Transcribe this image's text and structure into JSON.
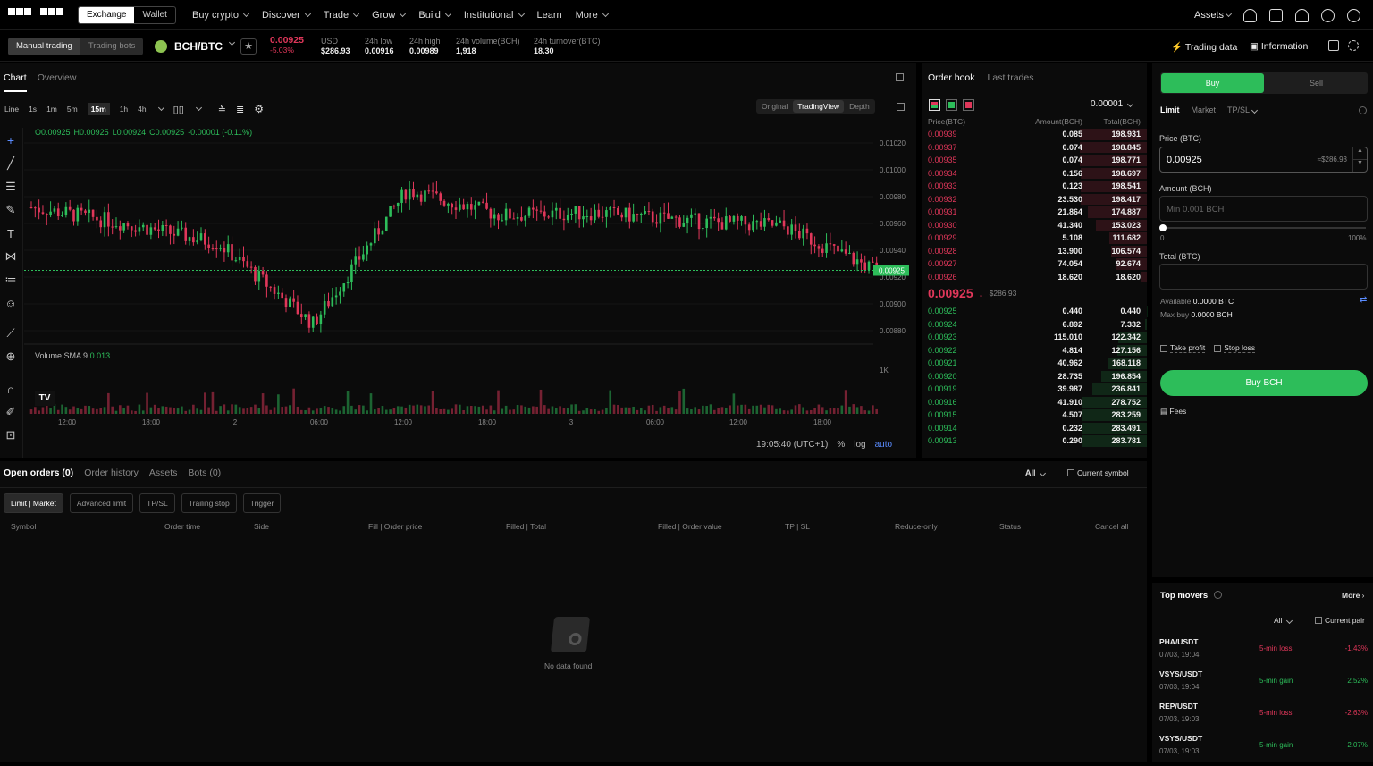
{
  "nav": {
    "exchange": "Exchange",
    "wallet": "Wallet",
    "menu": [
      "Buy crypto",
      "Discover",
      "Trade",
      "Grow",
      "Build",
      "Institutional",
      "Learn",
      "More"
    ],
    "assets": "Assets"
  },
  "ticker": {
    "mode": [
      "Manual trading",
      "Trading bots"
    ],
    "pair": "BCH/BTC",
    "price": "0.00925",
    "change": "-5.03%",
    "usd_label": "USD",
    "usd": "$286.93",
    "low_label": "24h low",
    "low": "0.00916",
    "high_label": "24h high",
    "high": "0.00989",
    "vol_label": "24h volume(BCH)",
    "vol": "1,918",
    "turn_label": "24h turnover(BTC)",
    "turn": "18.30",
    "trading_data": "Trading data",
    "information": "Information"
  },
  "chart": {
    "tabs": [
      "Chart",
      "Overview"
    ],
    "intervals": [
      "Line",
      "1s",
      "1m",
      "5m",
      "15m",
      "1h",
      "4h"
    ],
    "views": [
      "Original",
      "TradingView",
      "Depth"
    ],
    "ohlc_o": "O0.00925",
    "ohlc_h": "H0.00925",
    "ohlc_l": "L0.00924",
    "ohlc_c": "C0.00925",
    "ohlc_chg": "-0.00001 (-0.11%)",
    "volume_label": "Volume SMA 9",
    "volume_val": "0.013",
    "yticks": [
      "0.01020",
      "0.01000",
      "0.00980",
      "0.00960",
      "0.00940",
      "0.00920",
      "0.00900",
      "0.00880"
    ],
    "vol_tick": "1K",
    "xticks": [
      "12:00",
      "18:00",
      "2",
      "06:00",
      "12:00",
      "18:00",
      "3",
      "06:00",
      "12:00",
      "18:00"
    ],
    "last_price": "0.00925",
    "time": "19:05:40 (UTC+1)",
    "pct": "%",
    "log": "log",
    "auto": "auto"
  },
  "chart_data": {
    "type": "line",
    "title": "",
    "x": [
      "12:00",
      "18:00",
      "2",
      "06:00",
      "12:00",
      "18:00",
      "3",
      "06:00",
      "12:00",
      "18:00"
    ],
    "series": [
      {
        "name": "",
        "values": [
          0.00972,
          0.0096,
          0.00945,
          0.00885,
          0.00985,
          0.00966,
          0.00968,
          0.00962,
          0.00958,
          0.00925
        ]
      }
    ],
    "ylim": [
      0.0087,
      0.0103
    ]
  },
  "orderbook": {
    "tabs": [
      "Order book",
      "Last trades"
    ],
    "tick": "0.00001",
    "headers": [
      "Price(BTC)",
      "Amount(BCH)",
      "Total(BCH)"
    ],
    "asks": [
      [
        "0.00939",
        "0.085",
        "198.931"
      ],
      [
        "0.00937",
        "0.074",
        "198.845"
      ],
      [
        "0.00935",
        "0.074",
        "198.771"
      ],
      [
        "0.00934",
        "0.156",
        "198.697"
      ],
      [
        "0.00933",
        "0.123",
        "198.541"
      ],
      [
        "0.00932",
        "23.530",
        "198.417"
      ],
      [
        "0.00931",
        "21.864",
        "174.887"
      ],
      [
        "0.00930",
        "41.340",
        "153.023"
      ],
      [
        "0.00929",
        "5.108",
        "111.682"
      ],
      [
        "0.00928",
        "13.900",
        "106.574"
      ],
      [
        "0.00927",
        "74.054",
        "92.674"
      ],
      [
        "0.00926",
        "18.620",
        "18.620"
      ]
    ],
    "mid": "0.00925",
    "mid_usd": "$286.93",
    "bids": [
      [
        "0.00925",
        "0.440",
        "0.440"
      ],
      [
        "0.00924",
        "6.892",
        "7.332"
      ],
      [
        "0.00923",
        "115.010",
        "122.342"
      ],
      [
        "0.00922",
        "4.814",
        "127.156"
      ],
      [
        "0.00921",
        "40.962",
        "168.118"
      ],
      [
        "0.00920",
        "28.735",
        "196.854"
      ],
      [
        "0.00919",
        "39.987",
        "236.841"
      ],
      [
        "0.00916",
        "41.910",
        "278.752"
      ],
      [
        "0.00915",
        "4.507",
        "283.259"
      ],
      [
        "0.00914",
        "0.232",
        "283.491"
      ],
      [
        "0.00913",
        "0.290",
        "283.781"
      ]
    ]
  },
  "form": {
    "buy": "Buy",
    "sell": "Sell",
    "types": [
      "Limit",
      "Market",
      "TP/SL"
    ],
    "price_label": "Price (BTC)",
    "price": "0.00925",
    "price_usd": "≈$286.93",
    "amount_label": "Amount (BCH)",
    "amount_ph": "Min 0.001 BCH",
    "slider_min": "0",
    "slider_max": "100%",
    "total_label": "Total (BTC)",
    "available_label": "Available",
    "available": "0.0000 BTC",
    "maxbuy_label": "Max buy",
    "maxbuy": "0.0000 BCH",
    "take_profit": "Take profit",
    "stop_loss": "Stop loss",
    "submit": "Buy BCH",
    "fees": "Fees"
  },
  "orders": {
    "tabs": [
      "Open orders (0)",
      "Order history",
      "Assets",
      "Bots (0)"
    ],
    "filter": "All",
    "current": "Current symbol",
    "types": [
      "Limit | Market",
      "Advanced limit",
      "TP/SL",
      "Trailing stop",
      "Trigger"
    ],
    "cols": [
      "Symbol",
      "Order time",
      "Side",
      "Fill | Order price",
      "Filled | Total",
      "Filled | Order value",
      "TP | SL",
      "Reduce-only",
      "Status",
      "Cancel all"
    ],
    "empty": "No data found"
  },
  "movers": {
    "title": "Top movers",
    "more": "More",
    "filter": "All",
    "current": "Current pair",
    "items": [
      {
        "pair": "PHA/USDT",
        "date": "07/03, 19:04",
        "kind": "5-min loss",
        "val": "-1.43%"
      },
      {
        "pair": "VSYS/USDT",
        "date": "07/03, 19:04",
        "kind": "5-min gain",
        "val": "2.52%"
      },
      {
        "pair": "REP/USDT",
        "date": "07/03, 19:03",
        "kind": "5-min loss",
        "val": "-2.63%"
      },
      {
        "pair": "VSYS/USDT",
        "date": "07/03, 19:03",
        "kind": "5-min gain",
        "val": "2.07%"
      }
    ]
  },
  "colors": {
    "up": "#2dbd5a",
    "down": "#e0375a",
    "bg": "#0b0b0b"
  }
}
